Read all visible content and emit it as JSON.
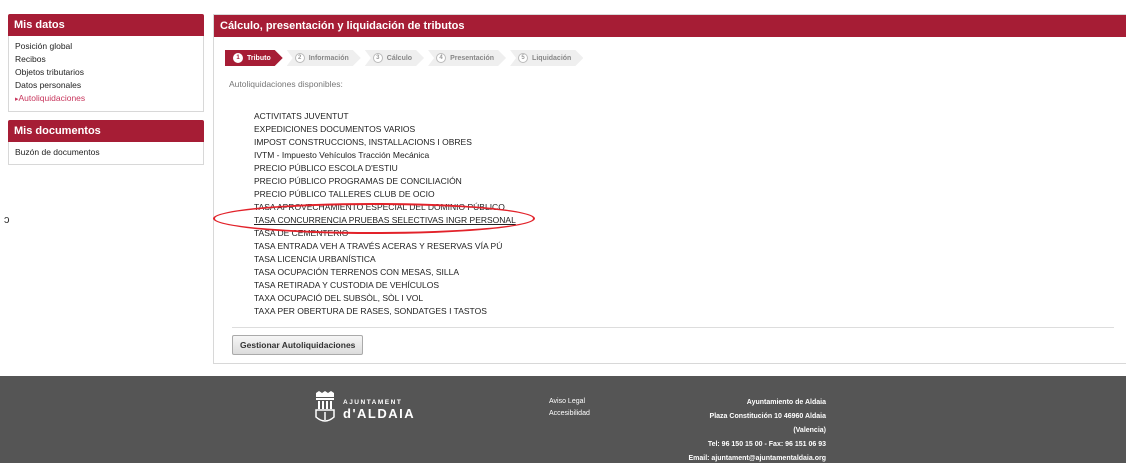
{
  "sidebar": {
    "mis_datos": {
      "title": "Mis datos",
      "items": [
        "Posición global",
        "Recibos",
        "Objetos tributarios",
        "Datos personales",
        "Autoliquidaciones"
      ]
    },
    "mis_documentos": {
      "title": "Mis documentos",
      "items": [
        "Buzón de documentos"
      ]
    }
  },
  "stray_mark": "ɔ",
  "main": {
    "title": "Cálculo, presentación y liquidación de tributos",
    "steps": [
      {
        "num": "1",
        "label": "Tributo"
      },
      {
        "num": "2",
        "label": "Información"
      },
      {
        "num": "3",
        "label": "Cálculo"
      },
      {
        "num": "4",
        "label": "Presentación"
      },
      {
        "num": "5",
        "label": "Liquidación"
      }
    ],
    "active_step": 1,
    "available_label": "Autoliquidaciones disponibles:",
    "tax_list": [
      "ACTIVITATS JUVENTUT",
      "EXPEDICIONES DOCUMENTOS VARIOS",
      "IMPOST CONSTRUCCIONS, INSTALLACIONS I OBRES",
      "IVTM - Impuesto Vehículos Tracción Mecánica",
      "PRECIO PÚBLICO ESCOLA D'ESTIU",
      "PRECIO PÚBLICO PROGRAMAS DE CONCILIACIÓN",
      "PRECIO PÚBLICO TALLERES CLUB DE OCIO",
      "TASA APROVECHAMIENTO ESPECIAL DEL DOMINIO PÚBLICO",
      "TASA CONCURRENCIA PRUEBAS SELECTIVAS INGR PERSONAL",
      "TASA DE CEMENTERIO",
      "TASA ENTRADA VEH A TRAVÉS ACERAS Y RESERVAS VÍA PÚ",
      "TASA LICENCIA URBANÍSTICA",
      "TASA OCUPACIÓN TERRENOS CON MESAS, SILLA",
      "TASA RETIRADA Y CUSTODIA DE VEHÍCULOS",
      "TAXA OCUPACIÓ DEL SUBSÒL, SÒL I VOL",
      "TAXA PER OBERTURA DE RASES, SONDATGES I TASTOS"
    ],
    "manage_button": "Gestionar Autoliquidaciones"
  },
  "footer": {
    "logo_top": "AJUNTAMENT",
    "logo_main": "d'ALDAIA",
    "links": [
      "Aviso Legal",
      "Accesibilidad"
    ],
    "contact": [
      "Ayuntamiento de Aldaia",
      "Plaza Constitución 10 46960 Aldaia",
      "(Valencia)",
      "Tel: 96 150 15 00 - Fax: 96 151 06 93",
      "Email: ajuntament@ajuntamentaldaia.org"
    ]
  },
  "colors": {
    "header_red": "#a61d35",
    "active_link": "#c8365d",
    "highlight": "#e2222a",
    "footer_bg": "#555555"
  }
}
